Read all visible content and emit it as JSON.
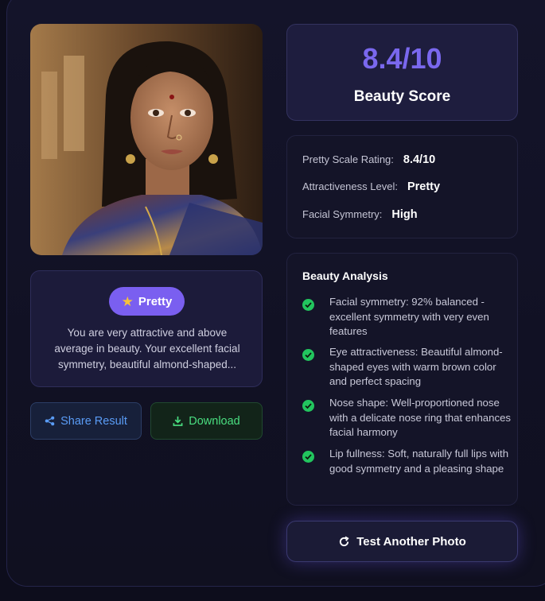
{
  "photo": {
    "alt": "Portrait of a woman in a saree with a nose ring"
  },
  "verdict": {
    "badge_label": "Pretty",
    "description": "You are very attractive and above average in beauty. Your excellent facial symmetry, beautiful almond-shaped..."
  },
  "actions": {
    "share_label": "Share Result",
    "download_label": "Download",
    "retest_label": "Test Another Photo"
  },
  "score": {
    "value": "8.4/10",
    "label": "Beauty Score"
  },
  "metrics": [
    {
      "label": "Pretty Scale Rating:",
      "value": "8.4/10"
    },
    {
      "label": "Attractiveness Level:",
      "value": "Pretty"
    },
    {
      "label": "Facial Symmetry:",
      "value": "High"
    }
  ],
  "analysis": {
    "title": "Beauty Analysis",
    "items": [
      "Facial symmetry: 92% balanced - excellent symmetry with very even features",
      "Eye attractiveness: Beautiful almond-shaped eyes with warm brown color and perfect spacing",
      "Nose shape: Well-proportioned nose with a delicate nose ring that enhances facial harmony",
      "Lip fullness: Soft, naturally full lips with good symmetry and a pleasing shape"
    ]
  },
  "colors": {
    "accent": "#7a68ee",
    "badge": "#7a5ff0",
    "share": "#5a9cf6",
    "download": "#4ade80",
    "check": "#22c55e"
  }
}
